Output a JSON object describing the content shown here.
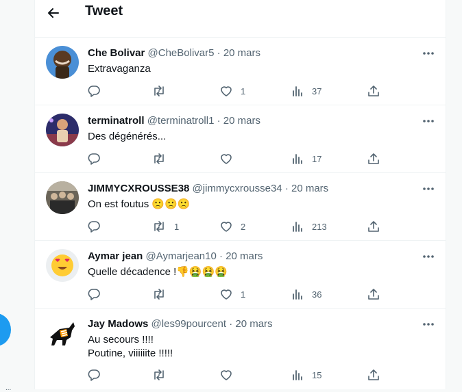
{
  "header": {
    "title": "Tweet",
    "back_icon": "arrow-left-icon"
  },
  "tweets": [
    {
      "name": "Che Bolivar",
      "handle": "@CheBolivar5",
      "date": "20 mars",
      "lines": [
        "Extravaganza",
        ""
      ],
      "replies": "",
      "retweets": "",
      "likes": "1",
      "views": "37"
    },
    {
      "name": "terminatroll",
      "handle": "@terminatroll1",
      "date": "20 mars",
      "lines": [
        "Des dégénérés...",
        ""
      ],
      "replies": "",
      "retweets": "",
      "likes": "",
      "views": "17"
    },
    {
      "name": "JIMMYCXROUSSE38",
      "handle": "@jimmycxrousse34",
      "date": "20 mars",
      "lines": [
        "On est foutus 🙁🙁🙁",
        ""
      ],
      "replies": "",
      "retweets": "1",
      "likes": "2",
      "views": "213"
    },
    {
      "name": "Aymar jean",
      "handle": "@Aymarjean10",
      "date": "20 mars",
      "lines": [
        "Quelle décadence !👎🤮🤮🤮",
        ""
      ],
      "replies": "",
      "retweets": "",
      "likes": "1",
      "views": "36"
    },
    {
      "name": "Jay Madows",
      "handle": "@les99pourcent",
      "date": "20 mars",
      "lines": [
        "Au secours !!!!",
        "Poutine, viiiiiite !!!!!"
      ],
      "replies": "",
      "retweets": "",
      "likes": "",
      "views": "15"
    }
  ],
  "dot_separator": "·",
  "edge_dots": "...",
  "colors": {
    "text": "#0f1419",
    "secondary": "#536471",
    "accent": "#1d9bf0",
    "border": "#eff3f4"
  },
  "icons": [
    "reply-icon",
    "retweet-icon",
    "like-icon",
    "views-icon",
    "share-icon",
    "more-icon"
  ]
}
